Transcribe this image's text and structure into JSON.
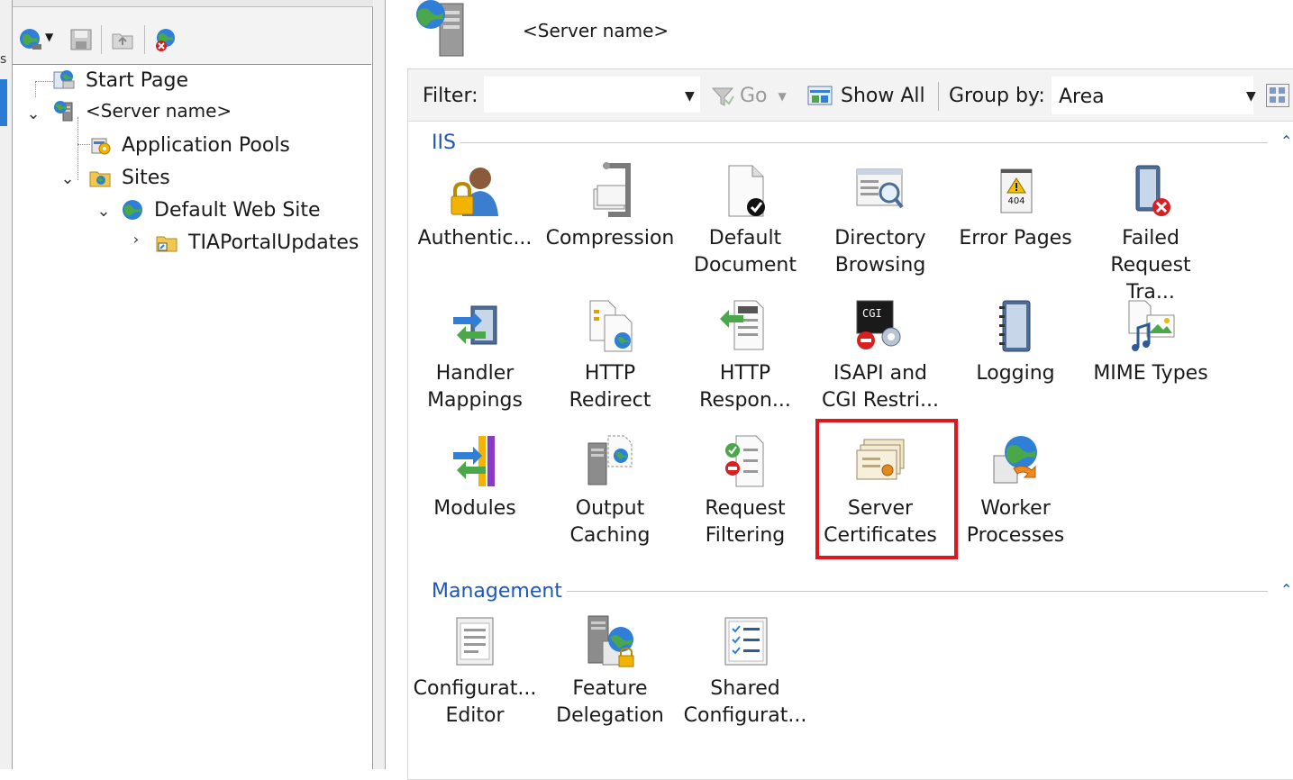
{
  "server": {
    "title": "<Server name>"
  },
  "connections_panel": {
    "toolbar_icons": [
      "connect-globe-icon",
      "save-icon",
      "up-folder-icon",
      "disconnect-icon"
    ],
    "tree": {
      "start_page": "Start Page",
      "server": "<Server name>",
      "application_pools": "Application Pools",
      "sites": "Sites",
      "default_web_site": "Default Web Site",
      "tia_portal_updates": "TIAPortalUpdates"
    }
  },
  "filter_bar": {
    "filter_label": "Filter:",
    "filter_value": "",
    "go_label": "Go",
    "show_all_label": "Show All",
    "group_by_label": "Group by:",
    "group_by_value": "Area"
  },
  "groups": {
    "iis": {
      "title": "IIS",
      "features": [
        {
          "label": "Authentic...",
          "icon": "authentication-icon"
        },
        {
          "label": "Compression",
          "icon": "compression-icon"
        },
        {
          "label": "Default\nDocument",
          "icon": "default-document-icon"
        },
        {
          "label": "Directory\nBrowsing",
          "icon": "directory-browsing-icon"
        },
        {
          "label": "Error Pages",
          "icon": "error-pages-icon"
        },
        {
          "label": "Failed\nRequest Tra...",
          "icon": "failed-request-tracing-icon"
        },
        {
          "label": "Handler\nMappings",
          "icon": "handler-mappings-icon"
        },
        {
          "label": "HTTP\nRedirect",
          "icon": "http-redirect-icon"
        },
        {
          "label": "HTTP\nRespon...",
          "icon": "http-response-headers-icon"
        },
        {
          "label": "ISAPI and\nCGI Restri...",
          "icon": "isapi-cgi-icon"
        },
        {
          "label": "Logging",
          "icon": "logging-icon"
        },
        {
          "label": "MIME Types",
          "icon": "mime-types-icon"
        },
        {
          "label": "Modules",
          "icon": "modules-icon"
        },
        {
          "label": "Output\nCaching",
          "icon": "output-caching-icon"
        },
        {
          "label": "Request\nFiltering",
          "icon": "request-filtering-icon"
        },
        {
          "label": "Server\nCertificates",
          "icon": "server-certificates-icon"
        },
        {
          "label": "Worker\nProcesses",
          "icon": "worker-processes-icon"
        }
      ]
    },
    "management": {
      "title": "Management",
      "features": [
        {
          "label": "Configurat...\nEditor",
          "icon": "configuration-editor-icon"
        },
        {
          "label": "Feature\nDelegation",
          "icon": "feature-delegation-icon"
        },
        {
          "label": "Shared\nConfigurat...",
          "icon": "shared-configuration-icon"
        }
      ]
    }
  },
  "colors": {
    "highlight": "#e0161f",
    "group_header": "#1f56b8"
  }
}
